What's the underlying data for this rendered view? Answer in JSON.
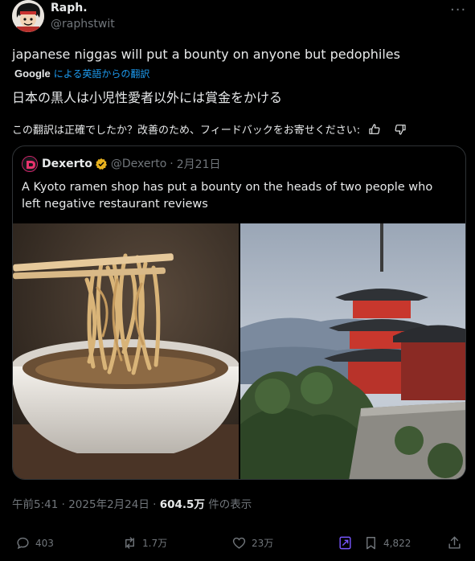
{
  "author": {
    "name": "Raph.",
    "handle": "@raphstwit"
  },
  "more_label": "···",
  "tweet": {
    "text": "japanese niggas will put a bounty on anyone but pedophiles",
    "translate_brand": "Google",
    "translate_link": "による英語からの翻訳",
    "translated_text": "日本の黒人は小児性愛者以外には賞金をかける",
    "feedback_prompt": "この翻訳は正確でしたか？改善のため、フィードバックをお寄せください:"
  },
  "quote": {
    "name": "Dexerto",
    "handle": "@Dexerto",
    "date": "2月21日",
    "text": "A Kyoto ramen shop has put a bounty on the heads of two people who left negative restaurant reviews"
  },
  "meta": {
    "time": "午前5:41",
    "date": "2025年2月24日",
    "views": "604.5万",
    "views_suffix": "件の表示",
    "sep": "·"
  },
  "actions": {
    "replies": "403",
    "reposts": "1.7万",
    "likes": "23万",
    "bookmarks": "4,822"
  },
  "colors": {
    "background": "#000000",
    "text": "#e7e9ea",
    "muted": "#71767b",
    "link": "#1d9bf0",
    "verified_gold": "#e8b21f",
    "grok_purple": "#7856ff"
  },
  "icons": [
    "thumbs-up-icon",
    "thumbs-down-icon",
    "verified-badge-icon",
    "reply-icon",
    "repost-icon",
    "like-icon",
    "grok-icon",
    "bookmark-icon",
    "share-icon"
  ]
}
